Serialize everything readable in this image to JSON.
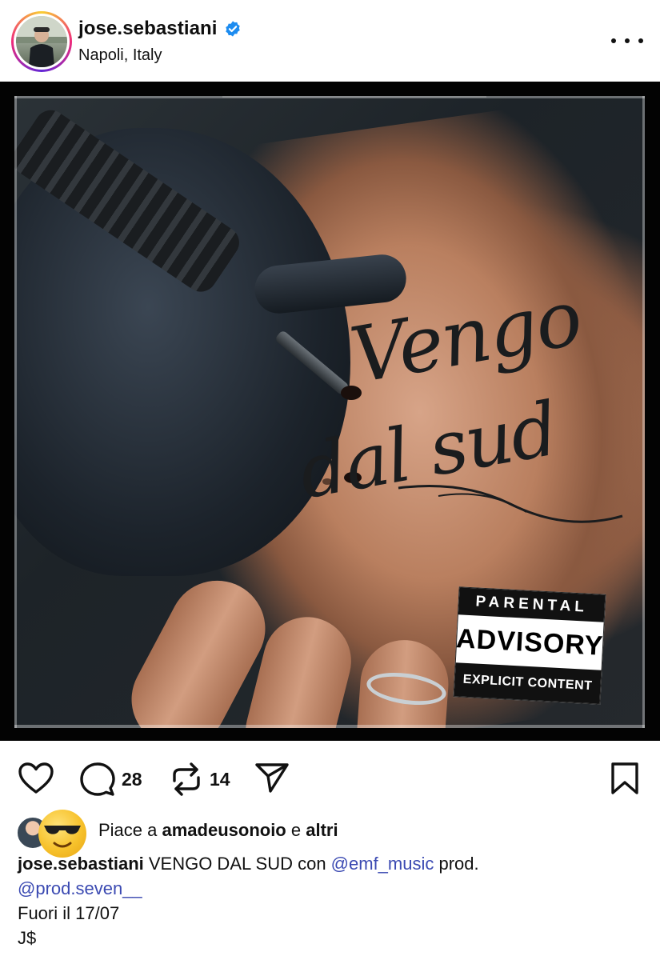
{
  "post": {
    "username": "jose.sebastiani",
    "verified": true,
    "location": "Napoli, Italy",
    "image": {
      "tattoo_line1": "Vengo",
      "tattoo_line2": "dal sud",
      "advisory_top": "PARENTAL",
      "advisory_mid": "ADVISORY",
      "advisory_bottom": "EXPLICIT CONTENT"
    }
  },
  "actions": {
    "comment_count": "28",
    "repost_count": "14"
  },
  "likes": {
    "prefix": "Piace a ",
    "user": "amadeusonoio",
    "middle": " e ",
    "suffix": "altri"
  },
  "caption": {
    "user": "jose.sebastiani",
    "text1": " VENGO DAL SUD con ",
    "mention1": "@emf_music",
    "text2": " prod.",
    "mention2": "@prod.seven__",
    "line3": "Fuori il 17/07",
    "line4": "J$"
  },
  "colors": {
    "mention": "#3b4ab2",
    "verified": "#1d8cf0",
    "text": "#111111"
  },
  "icons": [
    "verified-badge-icon",
    "more-options-icon",
    "heart-icon",
    "comment-icon",
    "repost-icon",
    "share-icon",
    "bookmark-icon",
    "sunglasses-emoji-icon"
  ]
}
